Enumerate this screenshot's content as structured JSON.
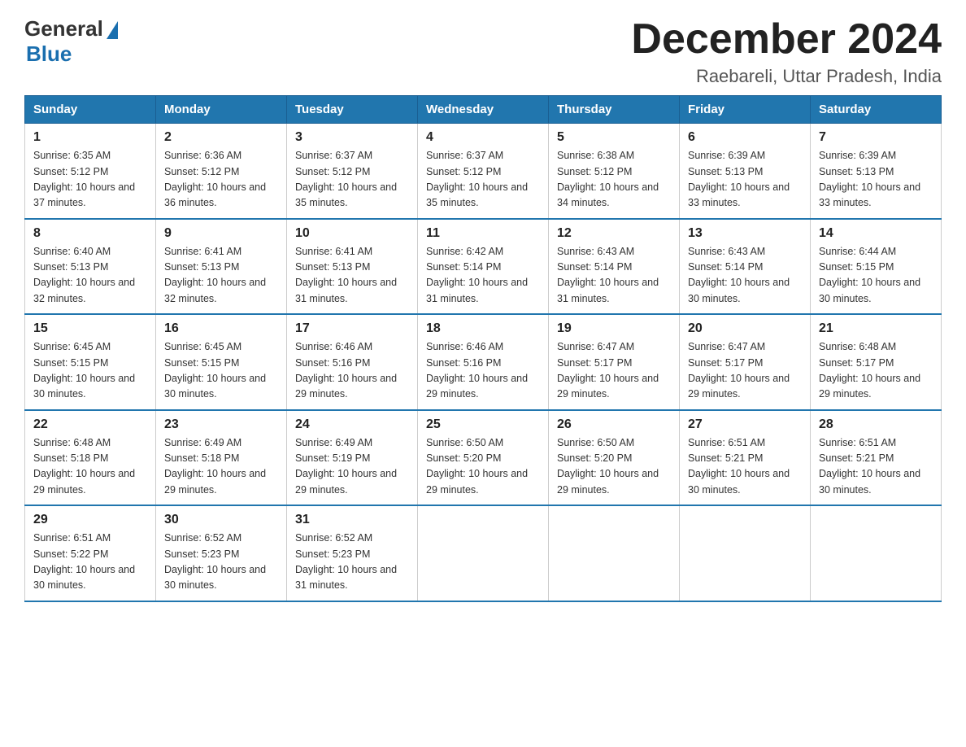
{
  "logo": {
    "general": "General",
    "blue": "Blue",
    "tagline": "Blue"
  },
  "header": {
    "month": "December 2024",
    "location": "Raebareli, Uttar Pradesh, India"
  },
  "weekdays": [
    "Sunday",
    "Monday",
    "Tuesday",
    "Wednesday",
    "Thursday",
    "Friday",
    "Saturday"
  ],
  "weeks": [
    [
      {
        "day": "1",
        "sunrise": "6:35 AM",
        "sunset": "5:12 PM",
        "daylight": "10 hours and 37 minutes."
      },
      {
        "day": "2",
        "sunrise": "6:36 AM",
        "sunset": "5:12 PM",
        "daylight": "10 hours and 36 minutes."
      },
      {
        "day": "3",
        "sunrise": "6:37 AM",
        "sunset": "5:12 PM",
        "daylight": "10 hours and 35 minutes."
      },
      {
        "day": "4",
        "sunrise": "6:37 AM",
        "sunset": "5:12 PM",
        "daylight": "10 hours and 35 minutes."
      },
      {
        "day": "5",
        "sunrise": "6:38 AM",
        "sunset": "5:12 PM",
        "daylight": "10 hours and 34 minutes."
      },
      {
        "day": "6",
        "sunrise": "6:39 AM",
        "sunset": "5:13 PM",
        "daylight": "10 hours and 33 minutes."
      },
      {
        "day": "7",
        "sunrise": "6:39 AM",
        "sunset": "5:13 PM",
        "daylight": "10 hours and 33 minutes."
      }
    ],
    [
      {
        "day": "8",
        "sunrise": "6:40 AM",
        "sunset": "5:13 PM",
        "daylight": "10 hours and 32 minutes."
      },
      {
        "day": "9",
        "sunrise": "6:41 AM",
        "sunset": "5:13 PM",
        "daylight": "10 hours and 32 minutes."
      },
      {
        "day": "10",
        "sunrise": "6:41 AM",
        "sunset": "5:13 PM",
        "daylight": "10 hours and 31 minutes."
      },
      {
        "day": "11",
        "sunrise": "6:42 AM",
        "sunset": "5:14 PM",
        "daylight": "10 hours and 31 minutes."
      },
      {
        "day": "12",
        "sunrise": "6:43 AM",
        "sunset": "5:14 PM",
        "daylight": "10 hours and 31 minutes."
      },
      {
        "day": "13",
        "sunrise": "6:43 AM",
        "sunset": "5:14 PM",
        "daylight": "10 hours and 30 minutes."
      },
      {
        "day": "14",
        "sunrise": "6:44 AM",
        "sunset": "5:15 PM",
        "daylight": "10 hours and 30 minutes."
      }
    ],
    [
      {
        "day": "15",
        "sunrise": "6:45 AM",
        "sunset": "5:15 PM",
        "daylight": "10 hours and 30 minutes."
      },
      {
        "day": "16",
        "sunrise": "6:45 AM",
        "sunset": "5:15 PM",
        "daylight": "10 hours and 30 minutes."
      },
      {
        "day": "17",
        "sunrise": "6:46 AM",
        "sunset": "5:16 PM",
        "daylight": "10 hours and 29 minutes."
      },
      {
        "day": "18",
        "sunrise": "6:46 AM",
        "sunset": "5:16 PM",
        "daylight": "10 hours and 29 minutes."
      },
      {
        "day": "19",
        "sunrise": "6:47 AM",
        "sunset": "5:17 PM",
        "daylight": "10 hours and 29 minutes."
      },
      {
        "day": "20",
        "sunrise": "6:47 AM",
        "sunset": "5:17 PM",
        "daylight": "10 hours and 29 minutes."
      },
      {
        "day": "21",
        "sunrise": "6:48 AM",
        "sunset": "5:17 PM",
        "daylight": "10 hours and 29 minutes."
      }
    ],
    [
      {
        "day": "22",
        "sunrise": "6:48 AM",
        "sunset": "5:18 PM",
        "daylight": "10 hours and 29 minutes."
      },
      {
        "day": "23",
        "sunrise": "6:49 AM",
        "sunset": "5:18 PM",
        "daylight": "10 hours and 29 minutes."
      },
      {
        "day": "24",
        "sunrise": "6:49 AM",
        "sunset": "5:19 PM",
        "daylight": "10 hours and 29 minutes."
      },
      {
        "day": "25",
        "sunrise": "6:50 AM",
        "sunset": "5:20 PM",
        "daylight": "10 hours and 29 minutes."
      },
      {
        "day": "26",
        "sunrise": "6:50 AM",
        "sunset": "5:20 PM",
        "daylight": "10 hours and 29 minutes."
      },
      {
        "day": "27",
        "sunrise": "6:51 AM",
        "sunset": "5:21 PM",
        "daylight": "10 hours and 30 minutes."
      },
      {
        "day": "28",
        "sunrise": "6:51 AM",
        "sunset": "5:21 PM",
        "daylight": "10 hours and 30 minutes."
      }
    ],
    [
      {
        "day": "29",
        "sunrise": "6:51 AM",
        "sunset": "5:22 PM",
        "daylight": "10 hours and 30 minutes."
      },
      {
        "day": "30",
        "sunrise": "6:52 AM",
        "sunset": "5:23 PM",
        "daylight": "10 hours and 30 minutes."
      },
      {
        "day": "31",
        "sunrise": "6:52 AM",
        "sunset": "5:23 PM",
        "daylight": "10 hours and 31 minutes."
      },
      null,
      null,
      null,
      null
    ]
  ]
}
